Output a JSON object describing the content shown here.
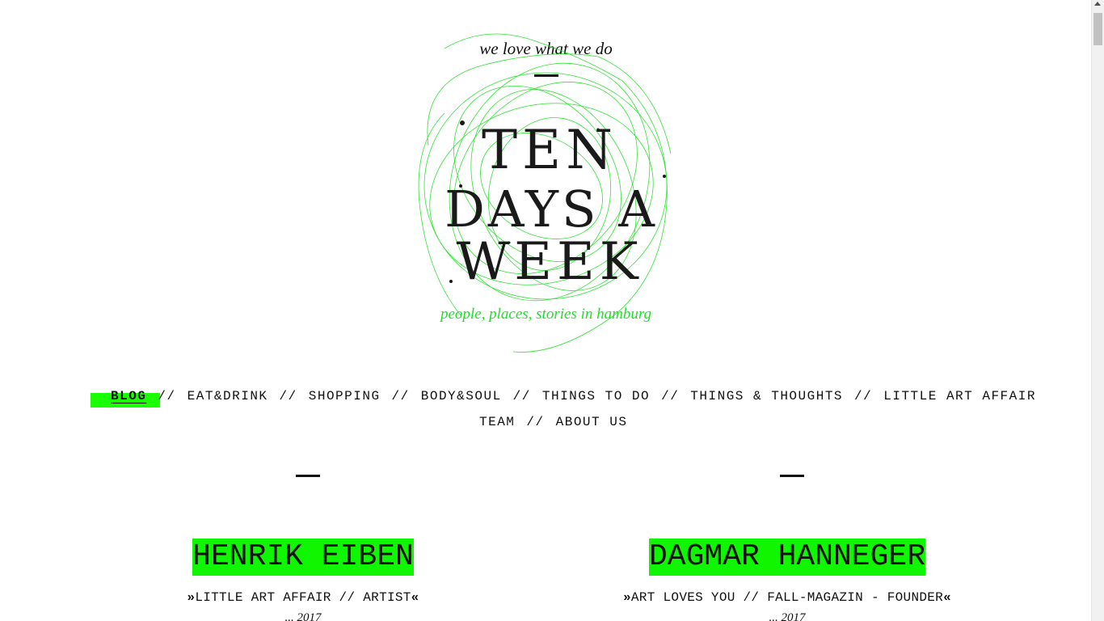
{
  "header": {
    "tagline": "we love what we do",
    "logo_text_lines": [
      "TEN",
      "DAYS A",
      "WEEK"
    ],
    "subtitle": "people, places, stories in hamburg"
  },
  "nav": {
    "line1": [
      {
        "label": "BLOG",
        "active": true
      },
      {
        "label": "EAT&DRINK"
      },
      {
        "label": "SHOPPING"
      },
      {
        "label": "BODY&SOUL"
      },
      {
        "label": "THINGS TO DO"
      },
      {
        "label": "THINGS & THOUGHTS"
      },
      {
        "label": "LITTLE ART AFFAIR"
      }
    ],
    "line2": [
      {
        "label": "TEAM"
      },
      {
        "label": "ABOUT US"
      }
    ],
    "separator": "//"
  },
  "posts": [
    {
      "title": "HENRIK EIBEN",
      "open_quote": "»",
      "subtitle": "LITTLE ART AFFAIR // ARTIST",
      "close_quote": "«",
      "date": "... 2017"
    },
    {
      "title": "DAGMAR HANNEGER",
      "open_quote": "»",
      "subtitle": "ART LOVES YOU // FALL-MAGAZIN - FOUNDER",
      "close_quote": "«",
      "date": "... 2017"
    }
  ],
  "colors": {
    "accent_green": "#10f500",
    "subtitle_green": "#1fe02a",
    "text": "#111111"
  }
}
